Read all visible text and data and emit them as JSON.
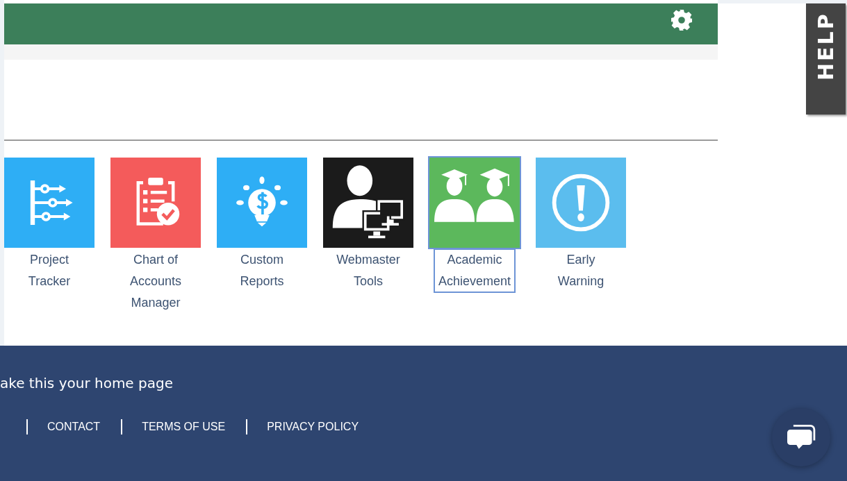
{
  "help_tab": {
    "label": "HELP"
  },
  "tiles": [
    {
      "kind": "tracker",
      "label": "Project Tracker",
      "color": "#2eaef5",
      "selected": false
    },
    {
      "kind": "checklist",
      "label": "Chart of Accounts Manager",
      "color": "#f45b5b",
      "selected": false
    },
    {
      "kind": "bulb",
      "label": "Custom Reports",
      "color": "#2eaef5",
      "selected": false
    },
    {
      "kind": "webmaster",
      "label": "Webmaster Tools",
      "color": "#1b1b1b",
      "selected": false
    },
    {
      "kind": "graduates",
      "label": "Academic Achievement",
      "color": "#5cb85c",
      "selected": true
    },
    {
      "kind": "warning",
      "label": "Early Warning",
      "color": "#5bbdee",
      "selected": false
    }
  ],
  "footer": {
    "home_link": "ake this your home page",
    "links": [
      "CONTACT",
      "TERMS OF USE",
      "PRIVACY POLICY"
    ]
  }
}
